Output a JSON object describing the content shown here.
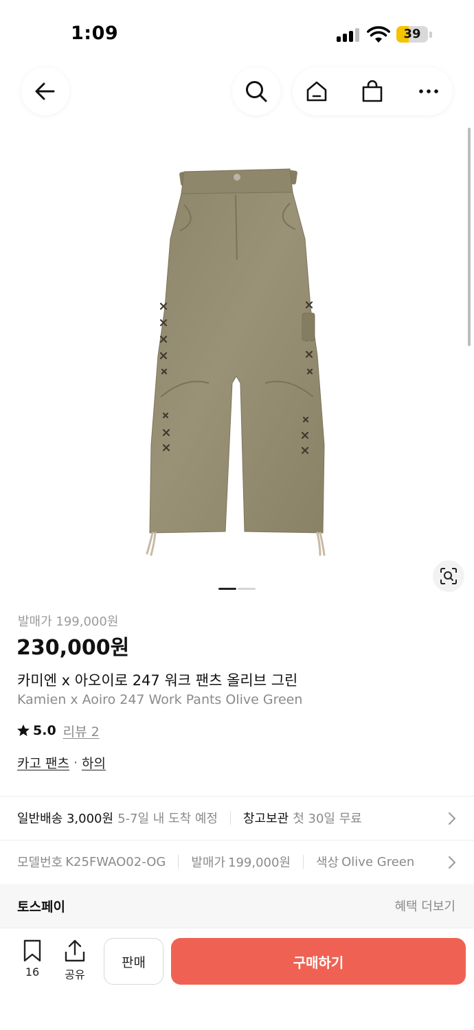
{
  "status_bar": {
    "time": "1:09",
    "battery_level": "39",
    "battery_fraction": 0.39,
    "battery_color": "#f5c400"
  },
  "nav": {
    "back_icon": "arrow-left-icon",
    "search_icon": "search-icon",
    "home_icon": "home-icon",
    "cart_icon": "shopping-bag-icon",
    "more_icon": "more-horizontal-icon"
  },
  "gallery": {
    "image_subject": "olive green suede work pants",
    "current_index": 1,
    "total": 2,
    "lens_icon": "image-search-icon"
  },
  "product": {
    "release_price_label": "발매가 199,000원",
    "price": "230,000원",
    "title_ko": "카미엔 x 아오이로 247 워크 팬츠 올리브 그린",
    "title_en": "Kamien x Aoiro 247 Work Pants Olive Green",
    "rating": "5.0",
    "review_label": "리뷰 2",
    "category_1": "카고 팬츠",
    "category_sep": "·",
    "category_2": "하의"
  },
  "shipping": {
    "standard_label": "일반배송 3,000원",
    "standard_eta": "5-7일 내 도착 예정",
    "warehouse_label": "창고보관",
    "warehouse_note": "첫 30일 무료"
  },
  "meta": {
    "model_label": "모델번호",
    "model_value": "K25FWAO02-OG",
    "release_label": "발매가",
    "release_value": "199,000원",
    "color_label": "색상",
    "color_value": "Olive Green"
  },
  "pay": {
    "title": "토스페이",
    "more": "혜택 더보기"
  },
  "bottom": {
    "bookmark_count": "16",
    "share_label": "공유",
    "sell_label": "판매",
    "buy_label": "구매하기",
    "buy_color": "#ef6253"
  }
}
